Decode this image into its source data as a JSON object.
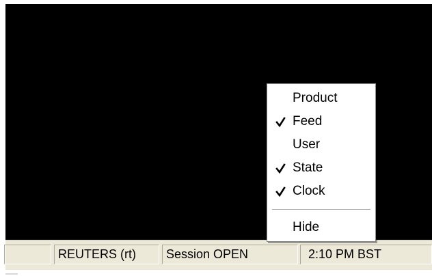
{
  "statusbar": {
    "pane_blank": "",
    "feed": "REUTERS (rt)",
    "session": "Session OPEN",
    "clock": "2:10 PM BST"
  },
  "context_menu": {
    "items": [
      {
        "label": "Product",
        "checked": false,
        "icon": ""
      },
      {
        "label": "Feed",
        "checked": true,
        "icon": "checkmark-icon"
      },
      {
        "label": "User",
        "checked": false,
        "icon": ""
      },
      {
        "label": "State",
        "checked": true,
        "icon": "checkmark-icon"
      },
      {
        "label": "Clock",
        "checked": true,
        "icon": "checkmark-icon"
      },
      {
        "label": "Hide",
        "checked": false,
        "icon": ""
      }
    ]
  },
  "colors": {
    "viewport_background": "#000000",
    "statusbar_background": "#ece9d8",
    "menu_background": "#ffffff"
  }
}
